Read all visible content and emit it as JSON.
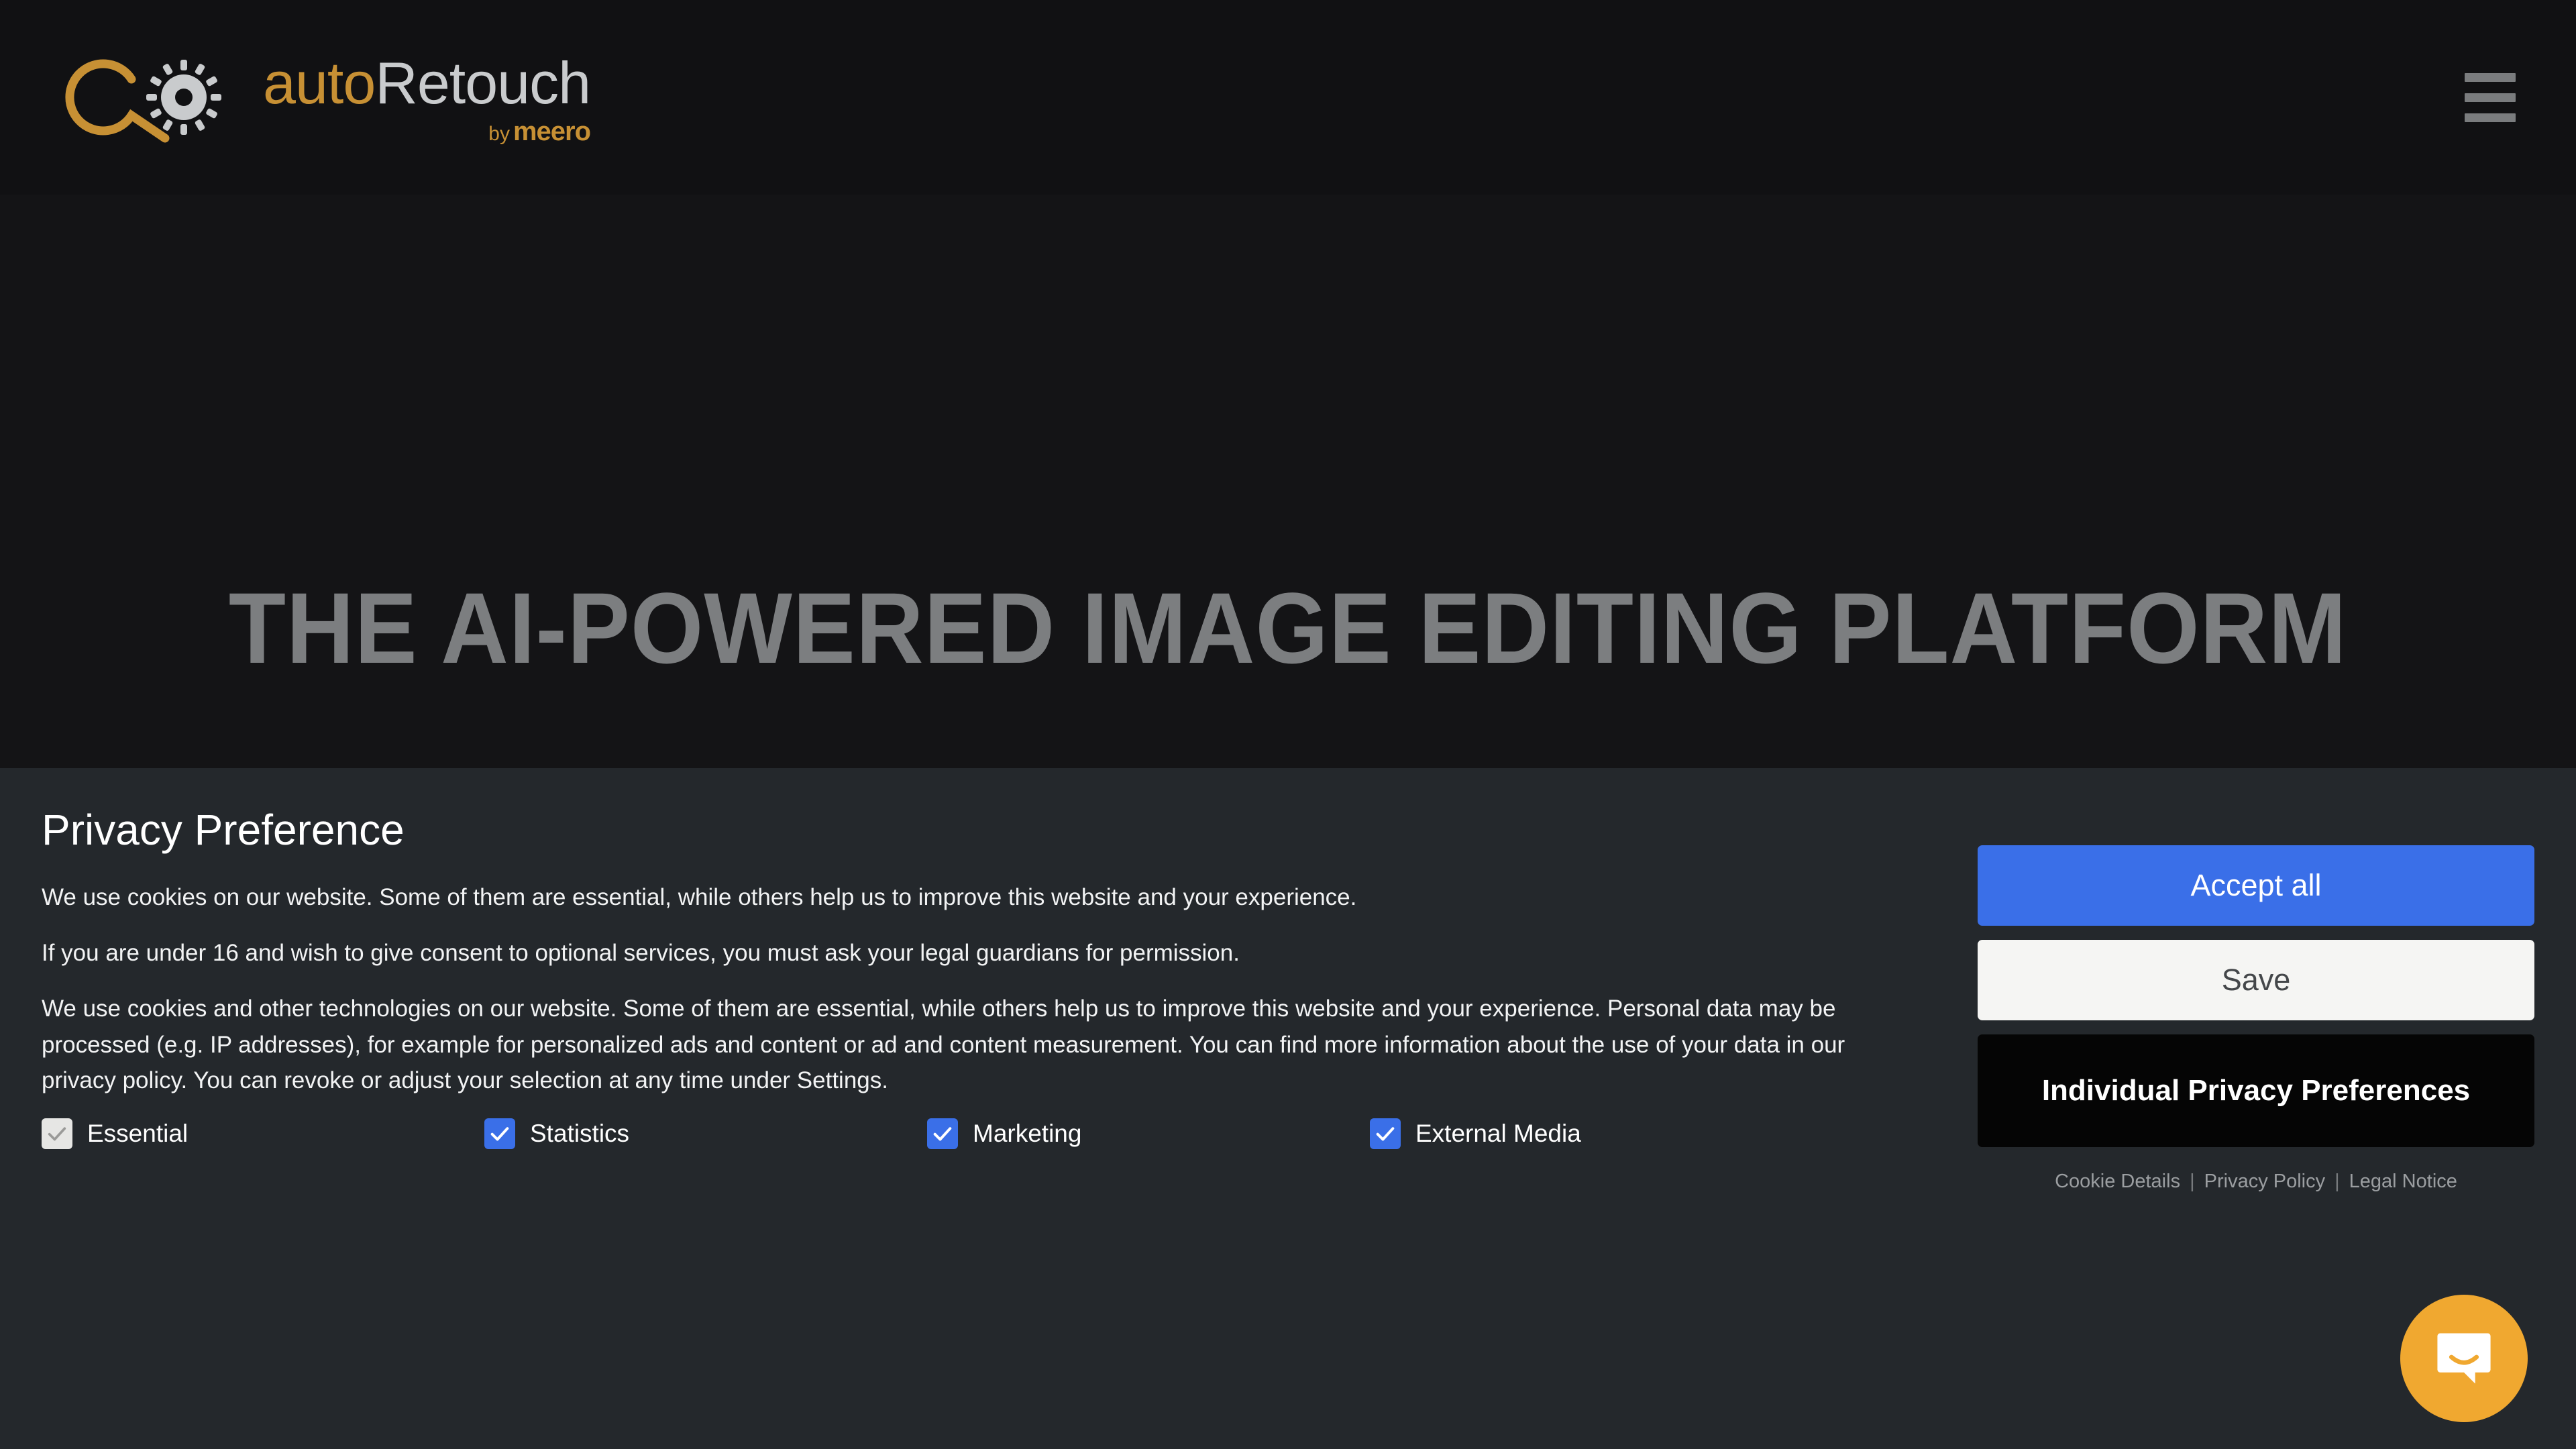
{
  "header": {
    "logo": {
      "word_auto": "auto",
      "word_retouch": "Retouch",
      "by": "by",
      "meero": "meero"
    },
    "menu_label": "Menu"
  },
  "hero": {
    "title": "THE AI-POWERED IMAGE EDITING PLATFORM"
  },
  "cookie_banner": {
    "title": "Privacy Preference",
    "paragraphs": [
      "We use cookies on our website. Some of them are essential, while others help us to improve this website and your experience.",
      "If you are under 16 and wish to give consent to optional services, you must ask your legal guardians for permission.",
      "We use cookies and other technologies on our website. Some of them are essential, while others help us to improve this website and your experience. Personal data may be processed (e.g. IP addresses), for example for personalized ads and content or ad and content measurement. You can find more information about the use of your data in our privacy policy. You can revoke or adjust your selection at any time under Settings."
    ],
    "checkboxes": [
      {
        "label": "Essential",
        "checked": true,
        "disabled": true
      },
      {
        "label": "Statistics",
        "checked": true,
        "disabled": false
      },
      {
        "label": "Marketing",
        "checked": true,
        "disabled": false
      },
      {
        "label": "External Media",
        "checked": true,
        "disabled": false
      }
    ],
    "buttons": {
      "accept_all": "Accept all",
      "save": "Save",
      "individual": "Individual Privacy Preferences"
    },
    "links": [
      "Cookie Details",
      "Privacy Policy",
      "Legal Notice"
    ],
    "link_separator": "|"
  },
  "chat": {
    "launcher_label": "Open Intercom Messenger"
  },
  "colors": {
    "accent_gold": "#c79034",
    "accent_blue": "#3a6fe8",
    "banner_bg": "#24282c",
    "page_bg": "#141416",
    "intercom_orange": "#f0a830"
  }
}
